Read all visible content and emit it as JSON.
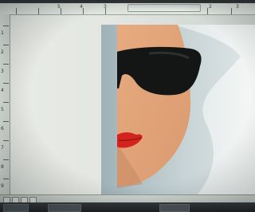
{
  "window": {
    "title": ""
  },
  "ruler": {
    "top_numbers": [
      "5",
      "4",
      "3",
      "2",
      "1",
      "0",
      "1",
      "2",
      "3",
      "4"
    ],
    "left_numbers": [
      "1",
      "2",
      "3",
      "4",
      "5",
      "6",
      "7",
      "8",
      "9"
    ]
  },
  "status": {
    "text": "",
    "nav_buttons": [
      "first",
      "previous",
      "next",
      "last"
    ]
  },
  "artwork": {
    "subject": "face with sunglasses and red lips",
    "colors": {
      "skin": "#e0a276",
      "skin_shadow": "#b97a55",
      "sunglasses": "#141515",
      "lips": "#d4231f",
      "hair": "#f1f4f3",
      "background": "#b8c7ca"
    }
  },
  "icons": [
    "ruler-icon",
    "nav-icon"
  ]
}
